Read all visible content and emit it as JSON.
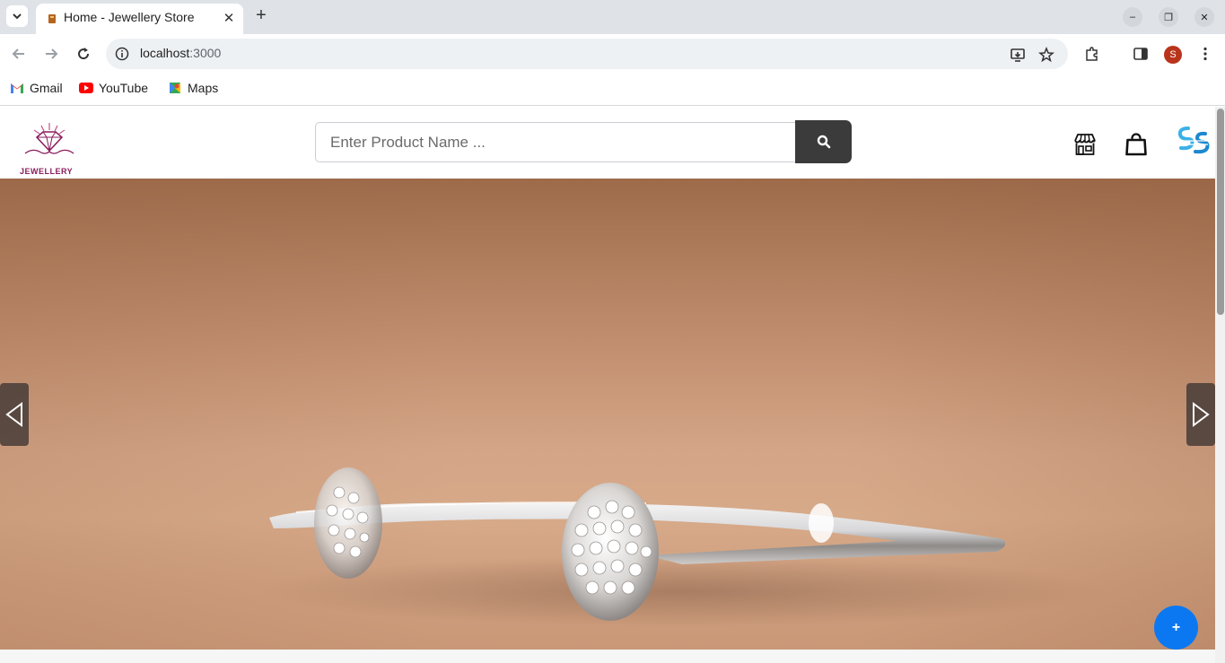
{
  "browser": {
    "tab_title": "Home - Jewellery Store",
    "tab_close": "✕",
    "new_tab": "+",
    "url_host": "localhost",
    "url_port": ":3000",
    "window_controls": {
      "minimize": "–",
      "restore": "❐",
      "close": "✕"
    },
    "profile_initial": "S",
    "bookmarks": [
      {
        "label": "Gmail",
        "icon": "gmail-icon"
      },
      {
        "label": "YouTube",
        "icon": "youtube-icon"
      },
      {
        "label": "Maps",
        "icon": "maps-icon"
      }
    ]
  },
  "site": {
    "logo_text": "JEWELLERY",
    "search": {
      "placeholder": "Enter Product Name ...",
      "button_icon": "search-icon"
    },
    "header_icons": [
      "store-icon",
      "shopping-bag-icon",
      "brand-logo-icon"
    ]
  },
  "hero": {
    "prev_icon": "chevron-left-icon",
    "next_icon": "chevron-right-icon"
  },
  "fab": {
    "label": "+"
  },
  "colors": {
    "search_button": "#3b3b3b",
    "fab": "#0b78f2",
    "profile": "#b8341b",
    "logo": "#8a1d5c"
  }
}
